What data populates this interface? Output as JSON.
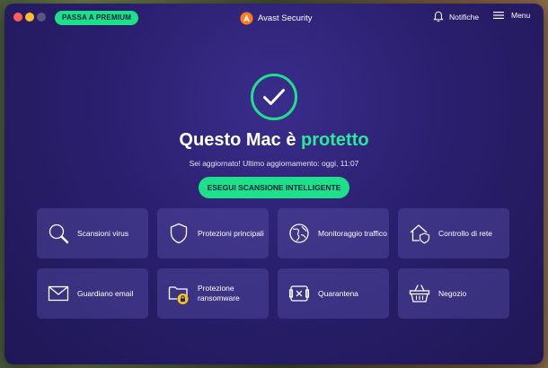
{
  "window": {
    "premium_label": "PASSA A PREMIUM",
    "app_title": "Avast Security",
    "notifications_label": "Notifiche",
    "menu_label": "Menu"
  },
  "hero": {
    "title_prefix": "Questo Mac è ",
    "title_status": "protetto",
    "subtitle": "Sei aggiornato! Ultimo aggiornamento: oggi, 11:07",
    "scan_button": "ESEGUI SCANSIONE INTELLIGENTE"
  },
  "tiles": [
    {
      "label": "Scansioni virus",
      "icon": "magnifier-icon"
    },
    {
      "label": "Protezioni principali",
      "icon": "shield-icon"
    },
    {
      "label": "Monitoraggio traffico",
      "icon": "globe-icon"
    },
    {
      "label": "Controllo di rete",
      "icon": "home-shield-icon"
    },
    {
      "label": "Guardiano email",
      "icon": "envelope-icon"
    },
    {
      "label": "Protezione ransomware",
      "icon": "folder-lock-icon"
    },
    {
      "label": "Quarantena",
      "icon": "quarantine-box-icon"
    },
    {
      "label": "Negozio",
      "icon": "basket-icon"
    }
  ],
  "colors": {
    "accent": "#1fe08a",
    "status_green": "#2ee89a",
    "background": "#2a1f6e",
    "tile": "#4f44a0",
    "brand_orange": "#ff7a1a"
  }
}
